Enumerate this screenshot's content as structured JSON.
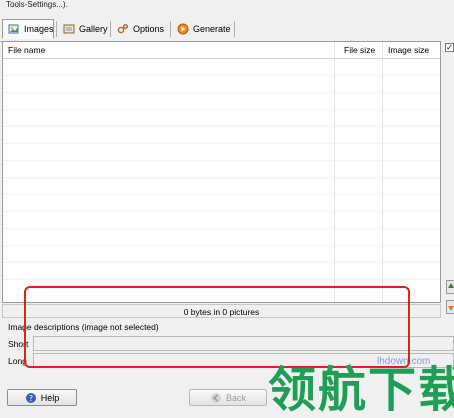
{
  "top_text": "Tools-Settings...).",
  "tabs": [
    {
      "label": "Images",
      "icon": "images-icon",
      "active": true
    },
    {
      "label": "Gallery",
      "icon": "gallery-icon",
      "active": false
    },
    {
      "label": "Options",
      "icon": "options-icon",
      "active": false
    },
    {
      "label": "Generate",
      "icon": "generate-icon",
      "active": false
    }
  ],
  "table": {
    "columns": [
      "File name",
      "File size",
      "Image size"
    ]
  },
  "status": "0 bytes in 0 pictures",
  "descriptions": {
    "title": "Image descriptions (image not selected)",
    "short_label": "Short",
    "long_label": "Long",
    "short_value": "",
    "long_value": ""
  },
  "buttons": {
    "help": "Help",
    "back": "Back"
  },
  "watermark": {
    "site": "lhdown.com",
    "text": "领航下载"
  },
  "colors": {
    "annotation_box": "#e02020",
    "watermark_green": "#1e9f55"
  }
}
